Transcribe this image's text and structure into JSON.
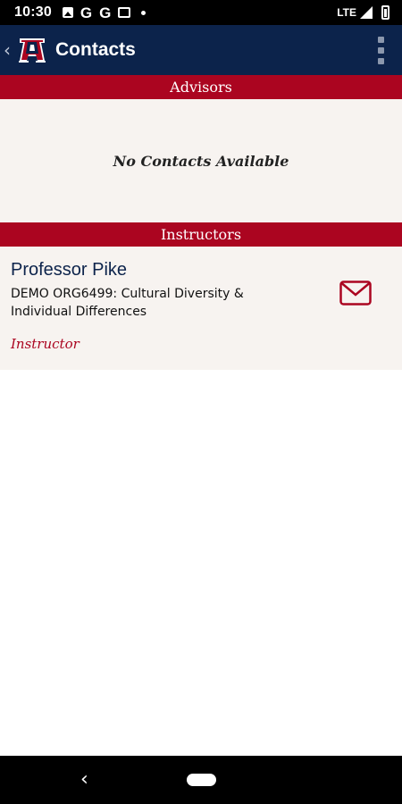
{
  "status_bar": {
    "time": "10:30",
    "left_icons": [
      "image-icon",
      "google-icon",
      "google-icon",
      "message-icon",
      "dot-icon"
    ],
    "g_letter": "G",
    "network": "LTE",
    "right_icons": [
      "lte-icon",
      "signal-icon",
      "battery-icon"
    ]
  },
  "app_bar": {
    "title": "Contacts",
    "back_icon": "chevron-left-icon",
    "logo": "university-of-arizona-logo",
    "menu_icon": "overflow-menu-icon"
  },
  "advisors": {
    "header": "Advisors",
    "empty_message": "No Contacts Available"
  },
  "instructors": {
    "header": "Instructors",
    "contacts": [
      {
        "name": "Professor Pike",
        "course": "DEMO ORG6499: Cultural Diversity & Individual Differences",
        "role": "Instructor",
        "action_icon": "email-icon"
      }
    ]
  },
  "nav_bar": {
    "back_icon": "back-triangle-icon",
    "home_icon": "home-pill-icon"
  },
  "colors": {
    "navy": "#0c234b",
    "red": "#ab0520",
    "card_bg": "#f7f3f0"
  }
}
